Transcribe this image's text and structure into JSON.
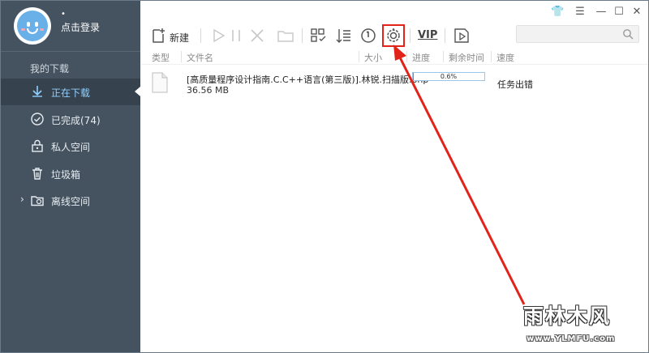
{
  "user": {
    "dot": "•",
    "login_label": "点击登录"
  },
  "sidebar": {
    "section_title": "我的下载",
    "items": [
      {
        "label": "正在下载",
        "icon": "download-arrow-icon"
      },
      {
        "label": "已完成(74)",
        "icon": "check-circle-icon"
      },
      {
        "label": "私人空间",
        "icon": "lock-icon"
      },
      {
        "label": "垃圾箱",
        "icon": "trash-icon"
      },
      {
        "label": "离线空间",
        "icon": "cloud-folder-icon"
      }
    ],
    "expand_glyph": "›"
  },
  "window_controls": {
    "skin": "👕",
    "menu": "☰",
    "minimize": "—",
    "maximize": "☐",
    "close": "✕"
  },
  "toolbar": {
    "new_label": "新建",
    "vip_label": "VIP"
  },
  "columns": {
    "type": "类型",
    "filename": "文件名",
    "size": "大小",
    "progress": "进度",
    "remaining": "剩余时间",
    "speed": "速度"
  },
  "task": {
    "filename": "[高质量程序设计指南.C.C++语言(第三版)].林锐.扫描版.php",
    "size": "36.56 MB",
    "progress_text": "0.6%",
    "progress_fraction": 0.006,
    "status": "任务出错"
  },
  "watermark": {
    "brand": "雨林木风",
    "url": "www.YLMFU.com"
  },
  "colors": {
    "sidebar": "#45525f",
    "active": "#36424d",
    "accent": "#3c9be8",
    "highlight": "#e2231a"
  }
}
